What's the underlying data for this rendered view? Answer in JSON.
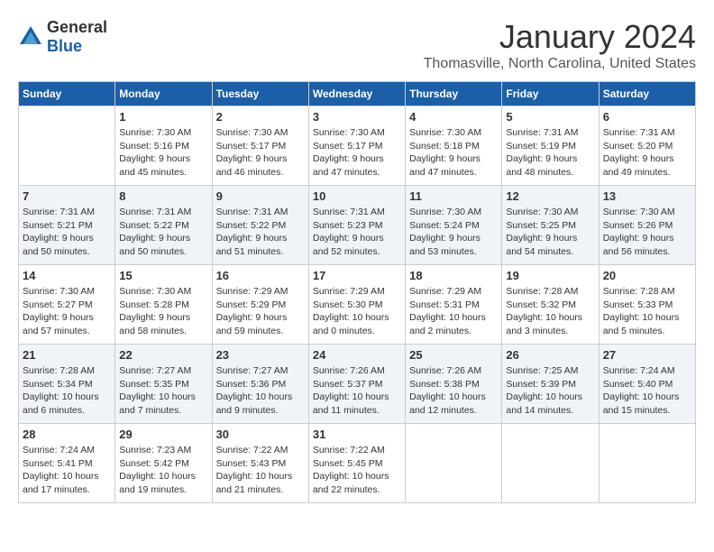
{
  "header": {
    "logo_general": "General",
    "logo_blue": "Blue",
    "month": "January 2024",
    "location": "Thomasville, North Carolina, United States"
  },
  "weekdays": [
    "Sunday",
    "Monday",
    "Tuesday",
    "Wednesday",
    "Thursday",
    "Friday",
    "Saturday"
  ],
  "weeks": [
    [
      {
        "day": "",
        "sunrise": "",
        "sunset": "",
        "daylight": ""
      },
      {
        "day": "1",
        "sunrise": "Sunrise: 7:30 AM",
        "sunset": "Sunset: 5:16 PM",
        "daylight": "Daylight: 9 hours and 45 minutes."
      },
      {
        "day": "2",
        "sunrise": "Sunrise: 7:30 AM",
        "sunset": "Sunset: 5:17 PM",
        "daylight": "Daylight: 9 hours and 46 minutes."
      },
      {
        "day": "3",
        "sunrise": "Sunrise: 7:30 AM",
        "sunset": "Sunset: 5:17 PM",
        "daylight": "Daylight: 9 hours and 47 minutes."
      },
      {
        "day": "4",
        "sunrise": "Sunrise: 7:30 AM",
        "sunset": "Sunset: 5:18 PM",
        "daylight": "Daylight: 9 hours and 47 minutes."
      },
      {
        "day": "5",
        "sunrise": "Sunrise: 7:31 AM",
        "sunset": "Sunset: 5:19 PM",
        "daylight": "Daylight: 9 hours and 48 minutes."
      },
      {
        "day": "6",
        "sunrise": "Sunrise: 7:31 AM",
        "sunset": "Sunset: 5:20 PM",
        "daylight": "Daylight: 9 hours and 49 minutes."
      }
    ],
    [
      {
        "day": "7",
        "sunrise": "Sunrise: 7:31 AM",
        "sunset": "Sunset: 5:21 PM",
        "daylight": "Daylight: 9 hours and 50 minutes."
      },
      {
        "day": "8",
        "sunrise": "Sunrise: 7:31 AM",
        "sunset": "Sunset: 5:22 PM",
        "daylight": "Daylight: 9 hours and 50 minutes."
      },
      {
        "day": "9",
        "sunrise": "Sunrise: 7:31 AM",
        "sunset": "Sunset: 5:22 PM",
        "daylight": "Daylight: 9 hours and 51 minutes."
      },
      {
        "day": "10",
        "sunrise": "Sunrise: 7:31 AM",
        "sunset": "Sunset: 5:23 PM",
        "daylight": "Daylight: 9 hours and 52 minutes."
      },
      {
        "day": "11",
        "sunrise": "Sunrise: 7:30 AM",
        "sunset": "Sunset: 5:24 PM",
        "daylight": "Daylight: 9 hours and 53 minutes."
      },
      {
        "day": "12",
        "sunrise": "Sunrise: 7:30 AM",
        "sunset": "Sunset: 5:25 PM",
        "daylight": "Daylight: 9 hours and 54 minutes."
      },
      {
        "day": "13",
        "sunrise": "Sunrise: 7:30 AM",
        "sunset": "Sunset: 5:26 PM",
        "daylight": "Daylight: 9 hours and 56 minutes."
      }
    ],
    [
      {
        "day": "14",
        "sunrise": "Sunrise: 7:30 AM",
        "sunset": "Sunset: 5:27 PM",
        "daylight": "Daylight: 9 hours and 57 minutes."
      },
      {
        "day": "15",
        "sunrise": "Sunrise: 7:30 AM",
        "sunset": "Sunset: 5:28 PM",
        "daylight": "Daylight: 9 hours and 58 minutes."
      },
      {
        "day": "16",
        "sunrise": "Sunrise: 7:29 AM",
        "sunset": "Sunset: 5:29 PM",
        "daylight": "Daylight: 9 hours and 59 minutes."
      },
      {
        "day": "17",
        "sunrise": "Sunrise: 7:29 AM",
        "sunset": "Sunset: 5:30 PM",
        "daylight": "Daylight: 10 hours and 0 minutes."
      },
      {
        "day": "18",
        "sunrise": "Sunrise: 7:29 AM",
        "sunset": "Sunset: 5:31 PM",
        "daylight": "Daylight: 10 hours and 2 minutes."
      },
      {
        "day": "19",
        "sunrise": "Sunrise: 7:28 AM",
        "sunset": "Sunset: 5:32 PM",
        "daylight": "Daylight: 10 hours and 3 minutes."
      },
      {
        "day": "20",
        "sunrise": "Sunrise: 7:28 AM",
        "sunset": "Sunset: 5:33 PM",
        "daylight": "Daylight: 10 hours and 5 minutes."
      }
    ],
    [
      {
        "day": "21",
        "sunrise": "Sunrise: 7:28 AM",
        "sunset": "Sunset: 5:34 PM",
        "daylight": "Daylight: 10 hours and 6 minutes."
      },
      {
        "day": "22",
        "sunrise": "Sunrise: 7:27 AM",
        "sunset": "Sunset: 5:35 PM",
        "daylight": "Daylight: 10 hours and 7 minutes."
      },
      {
        "day": "23",
        "sunrise": "Sunrise: 7:27 AM",
        "sunset": "Sunset: 5:36 PM",
        "daylight": "Daylight: 10 hours and 9 minutes."
      },
      {
        "day": "24",
        "sunrise": "Sunrise: 7:26 AM",
        "sunset": "Sunset: 5:37 PM",
        "daylight": "Daylight: 10 hours and 11 minutes."
      },
      {
        "day": "25",
        "sunrise": "Sunrise: 7:26 AM",
        "sunset": "Sunset: 5:38 PM",
        "daylight": "Daylight: 10 hours and 12 minutes."
      },
      {
        "day": "26",
        "sunrise": "Sunrise: 7:25 AM",
        "sunset": "Sunset: 5:39 PM",
        "daylight": "Daylight: 10 hours and 14 minutes."
      },
      {
        "day": "27",
        "sunrise": "Sunrise: 7:24 AM",
        "sunset": "Sunset: 5:40 PM",
        "daylight": "Daylight: 10 hours and 15 minutes."
      }
    ],
    [
      {
        "day": "28",
        "sunrise": "Sunrise: 7:24 AM",
        "sunset": "Sunset: 5:41 PM",
        "daylight": "Daylight: 10 hours and 17 minutes."
      },
      {
        "day": "29",
        "sunrise": "Sunrise: 7:23 AM",
        "sunset": "Sunset: 5:42 PM",
        "daylight": "Daylight: 10 hours and 19 minutes."
      },
      {
        "day": "30",
        "sunrise": "Sunrise: 7:22 AM",
        "sunset": "Sunset: 5:43 PM",
        "daylight": "Daylight: 10 hours and 21 minutes."
      },
      {
        "day": "31",
        "sunrise": "Sunrise: 7:22 AM",
        "sunset": "Sunset: 5:45 PM",
        "daylight": "Daylight: 10 hours and 22 minutes."
      },
      {
        "day": "",
        "sunrise": "",
        "sunset": "",
        "daylight": ""
      },
      {
        "day": "",
        "sunrise": "",
        "sunset": "",
        "daylight": ""
      },
      {
        "day": "",
        "sunrise": "",
        "sunset": "",
        "daylight": ""
      }
    ]
  ]
}
